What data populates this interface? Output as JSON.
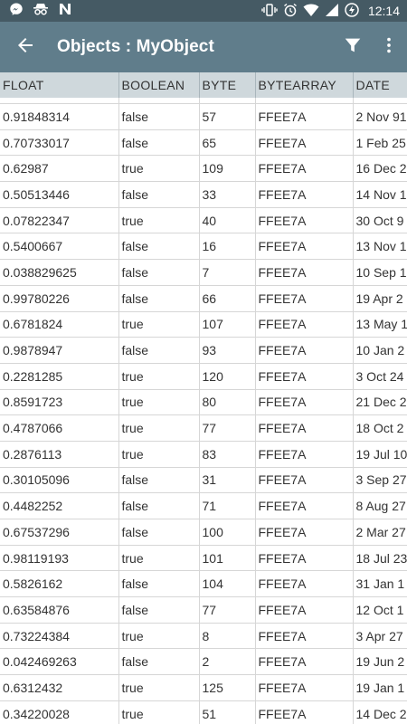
{
  "status_bar": {
    "time": "12:14",
    "left_icons": [
      "messenger-icon",
      "incognito-icon",
      "n-app-icon"
    ],
    "right_icons": [
      "vibrate-icon",
      "alarm-icon",
      "wifi-icon",
      "signal-icon",
      "battery-charging-icon"
    ]
  },
  "app_bar": {
    "title": "Objects : MyObject",
    "back_icon": "arrow-back-icon",
    "filter_icon": "filter-icon",
    "menu_icon": "more-vert-icon"
  },
  "colors": {
    "status_bar": "#455a64",
    "app_bar": "#607d8b",
    "header_row": "#cfd8dc"
  },
  "table": {
    "columns": [
      "FLOAT",
      "BOOLEAN",
      "BYTE",
      "BYTEARRAY",
      "DATE"
    ],
    "rows": [
      [
        "0.91848314",
        "false",
        "57",
        "FFEE7A",
        "2 Nov 91"
      ],
      [
        "0.70733017",
        "false",
        "65",
        "FFEE7A",
        "1 Feb 25"
      ],
      [
        "0.62987",
        "true",
        "109",
        "FFEE7A",
        "16 Dec 2"
      ],
      [
        "0.50513446",
        "false",
        "33",
        "FFEE7A",
        "14 Nov 1"
      ],
      [
        "0.07822347",
        "true",
        "40",
        "FFEE7A",
        "30 Oct 9"
      ],
      [
        "0.5400667",
        "false",
        "16",
        "FFEE7A",
        "13 Nov 1"
      ],
      [
        "0.038829625",
        "false",
        "7",
        "FFEE7A",
        "10 Sep 1"
      ],
      [
        "0.99780226",
        "false",
        "66",
        "FFEE7A",
        "19 Apr 2"
      ],
      [
        "0.6781824",
        "true",
        "107",
        "FFEE7A",
        "13 May 1"
      ],
      [
        "0.9878947",
        "false",
        "93",
        "FFEE7A",
        "10 Jan 2"
      ],
      [
        "0.2281285",
        "true",
        "120",
        "FFEE7A",
        "3 Oct 24"
      ],
      [
        "0.8591723",
        "true",
        "80",
        "FFEE7A",
        "21 Dec 2"
      ],
      [
        "0.4787066",
        "true",
        "77",
        "FFEE7A",
        "18 Oct 2"
      ],
      [
        "0.2876113",
        "true",
        "83",
        "FFEE7A",
        "19 Jul 10"
      ],
      [
        "0.30105096",
        "false",
        "31",
        "FFEE7A",
        "3 Sep 27"
      ],
      [
        "0.4482252",
        "false",
        "71",
        "FFEE7A",
        "8 Aug 27"
      ],
      [
        "0.67537296",
        "false",
        "100",
        "FFEE7A",
        "2 Mar 27"
      ],
      [
        "0.98119193",
        "true",
        "101",
        "FFEE7A",
        "18 Jul 23"
      ],
      [
        "0.5826162",
        "false",
        "104",
        "FFEE7A",
        "31 Jan 1"
      ],
      [
        "0.63584876",
        "false",
        "77",
        "FFEE7A",
        "12 Oct 1"
      ],
      [
        "0.73224384",
        "true",
        "8",
        "FFEE7A",
        "3 Apr 27"
      ],
      [
        "0.042469263",
        "false",
        "2",
        "FFEE7A",
        "19 Jun 2"
      ],
      [
        "0.6312432",
        "true",
        "125",
        "FFEE7A",
        "19 Jan 1"
      ],
      [
        "0.34220028",
        "true",
        "51",
        "FFEE7A",
        "14 Dec 2"
      ]
    ]
  }
}
